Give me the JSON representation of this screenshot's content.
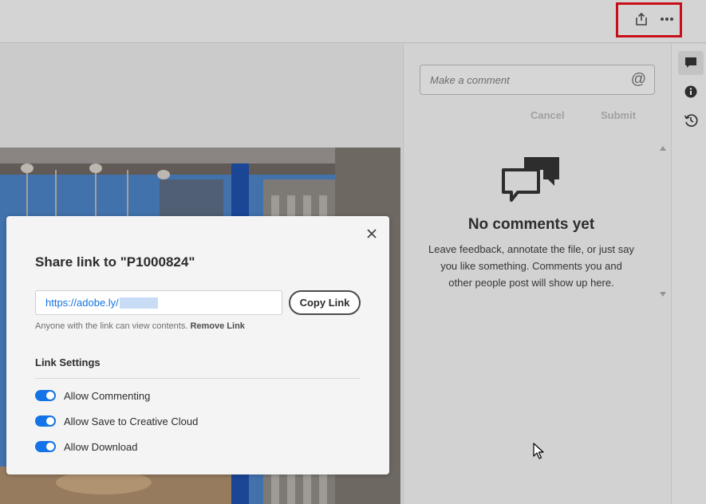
{
  "topbar": {
    "share_icon": "share-icon",
    "more_icon": "more-icon",
    "highlight_color": "#e0101d"
  },
  "comments": {
    "placeholder": "Make a comment",
    "mention_symbol": "@",
    "cancel_label": "Cancel",
    "submit_label": "Submit",
    "empty_title": "No comments yet",
    "empty_text": "Leave feedback, annotate the file, or just say you like something. Comments you and other people post will show up here."
  },
  "rail": {
    "items": [
      "comment-icon",
      "info-icon",
      "history-icon"
    ]
  },
  "share_modal": {
    "title": "Share link to \"P1000824\"",
    "link_value": "https://adobe.ly/",
    "copy_label": "Copy Link",
    "note": "Anyone with the link can view contents.",
    "remove_link_label": "Remove Link",
    "settings_title": "Link Settings",
    "settings": [
      {
        "label": "Allow Commenting",
        "enabled": true
      },
      {
        "label": "Allow Save to Creative Cloud",
        "enabled": true
      },
      {
        "label": "Allow Download",
        "enabled": true
      }
    ],
    "accent_color": "#1473e6"
  }
}
